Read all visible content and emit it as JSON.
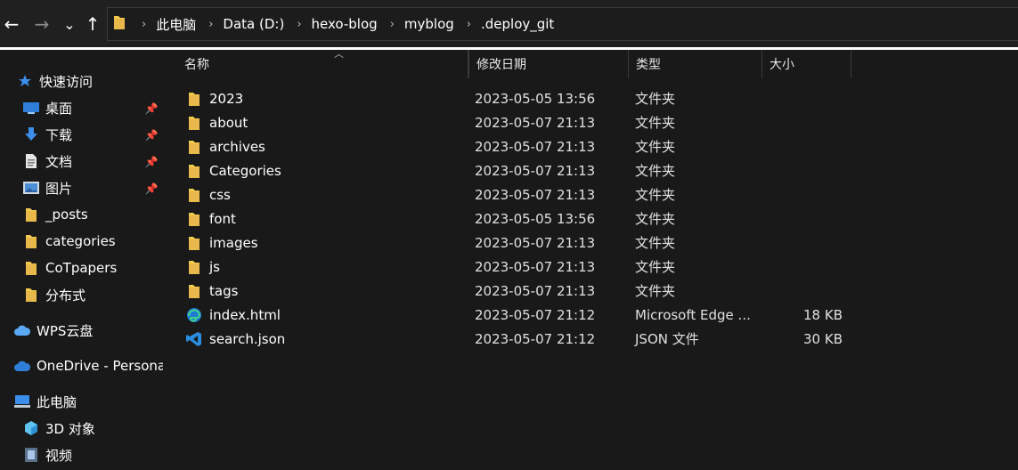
{
  "address": {
    "crumbs": [
      "此电脑",
      "Data (D:)",
      "hexo-blog",
      "myblog",
      ".deploy_git"
    ],
    "separator": "›"
  },
  "nav": {
    "back": "←",
    "forward": "→",
    "recent": "⌄",
    "up": "↑"
  },
  "sidebar": {
    "quick_access": "快速访问",
    "pinned": [
      {
        "label": "桌面",
        "icon": "desktop-icon"
      },
      {
        "label": "下载",
        "icon": "download-icon"
      },
      {
        "label": "文档",
        "icon": "document-icon"
      },
      {
        "label": "图片",
        "icon": "pictures-icon"
      }
    ],
    "folders": [
      "_posts",
      "categories",
      "CoTpapers",
      "分布式"
    ],
    "wps": "WPS云盘",
    "onedrive": "OneDrive - Persona",
    "this_pc": "此电脑",
    "pc_items": [
      {
        "label": "3D 对象",
        "icon": "3d-objects-icon"
      },
      {
        "label": "视频",
        "icon": "video-icon"
      }
    ]
  },
  "columns": {
    "name": "名称",
    "modified": "修改日期",
    "type": "类型",
    "size": "大小"
  },
  "files": [
    {
      "name": "2023",
      "modified": "2023-05-05 13:56",
      "type": "文件夹",
      "size": "",
      "icon": "folder-icon"
    },
    {
      "name": "about",
      "modified": "2023-05-07 21:13",
      "type": "文件夹",
      "size": "",
      "icon": "folder-icon"
    },
    {
      "name": "archives",
      "modified": "2023-05-07 21:13",
      "type": "文件夹",
      "size": "",
      "icon": "folder-icon"
    },
    {
      "name": "Categories",
      "modified": "2023-05-07 21:13",
      "type": "文件夹",
      "size": "",
      "icon": "folder-icon"
    },
    {
      "name": "css",
      "modified": "2023-05-07 21:13",
      "type": "文件夹",
      "size": "",
      "icon": "folder-icon"
    },
    {
      "name": "font",
      "modified": "2023-05-05 13:56",
      "type": "文件夹",
      "size": "",
      "icon": "folder-icon"
    },
    {
      "name": "images",
      "modified": "2023-05-07 21:13",
      "type": "文件夹",
      "size": "",
      "icon": "folder-icon"
    },
    {
      "name": "js",
      "modified": "2023-05-07 21:13",
      "type": "文件夹",
      "size": "",
      "icon": "folder-icon"
    },
    {
      "name": "tags",
      "modified": "2023-05-07 21:13",
      "type": "文件夹",
      "size": "",
      "icon": "folder-icon"
    },
    {
      "name": "index.html",
      "modified": "2023-05-07 21:12",
      "type": "Microsoft Edge ...",
      "size": "18 KB",
      "icon": "edge-icon"
    },
    {
      "name": "search.json",
      "modified": "2023-05-07 21:12",
      "type": "JSON 文件",
      "size": "30 KB",
      "icon": "vscode-icon"
    }
  ],
  "colors": {
    "folder": "#f2c94c",
    "folder_dark": "#d9a93a",
    "accent_blue": "#3b8eea",
    "background": "#191919"
  }
}
